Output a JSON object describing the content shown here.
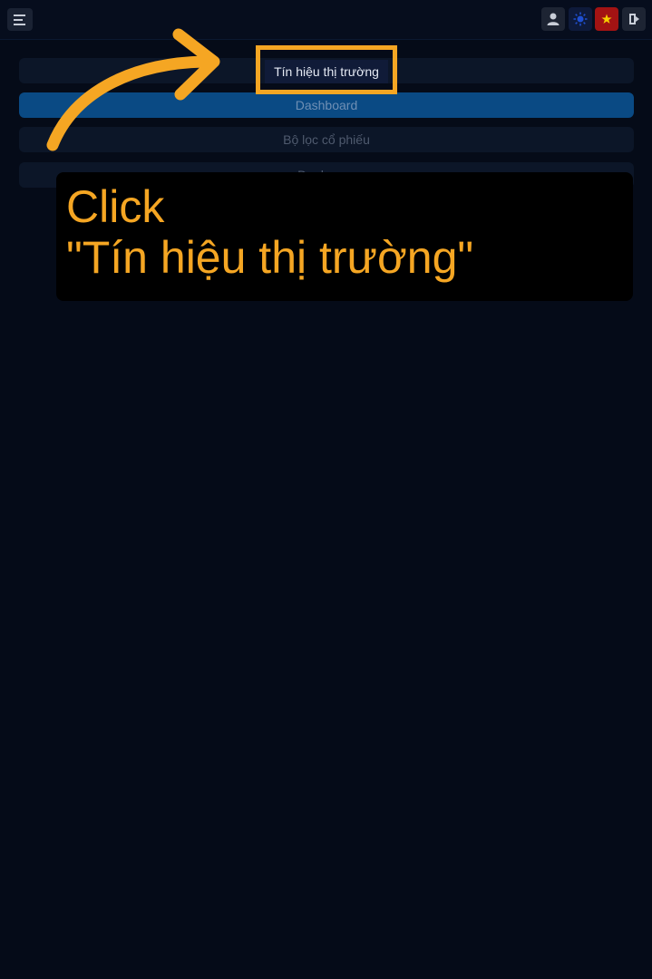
{
  "topbar": {
    "icons": [
      "menu-icon",
      "user-icon",
      "theme-toggle-icon",
      "vietnam-flag-icon",
      "logout-icon"
    ]
  },
  "nav": {
    "items": [
      {
        "label": "Tín hiệu thị trường"
      },
      {
        "label": "Dashboard"
      },
      {
        "label": "Bộ lọc cổ phiếu"
      },
      {
        "label": "Danh mục"
      }
    ]
  },
  "tutorial": {
    "line1": "Click",
    "line2": "\"Tín hiệu thị trường\"",
    "accent_color": "#f5a623"
  },
  "colors": {
    "background": "#050b18",
    "active_item": "#0a4a84",
    "flag_red": "#a31313"
  }
}
